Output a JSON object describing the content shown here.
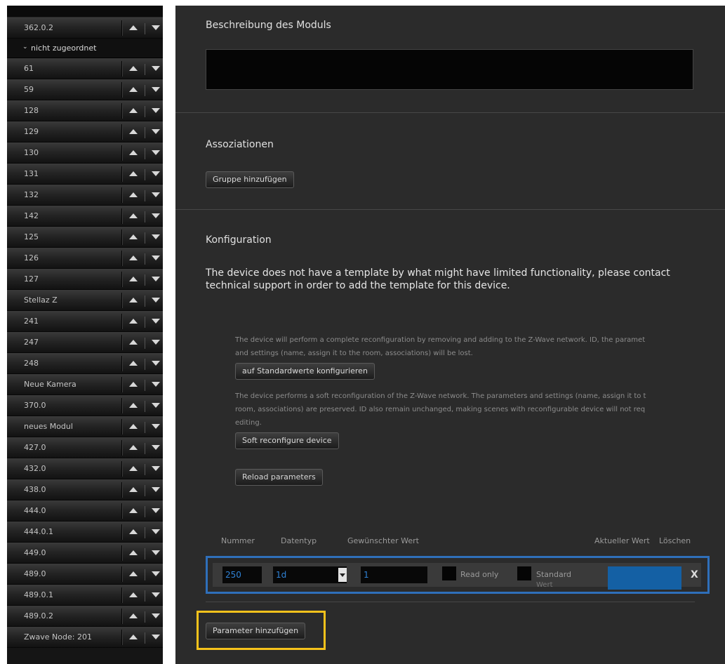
{
  "sidebar": {
    "items": [
      {
        "type": "item",
        "label": "362.0.2"
      },
      {
        "type": "group",
        "label": "nicht zugeordnet",
        "chevron": "⌄"
      },
      {
        "type": "item",
        "label": "61"
      },
      {
        "type": "item",
        "label": "59"
      },
      {
        "type": "item",
        "label": "128"
      },
      {
        "type": "item",
        "label": "129"
      },
      {
        "type": "item",
        "label": "130"
      },
      {
        "type": "item",
        "label": "131"
      },
      {
        "type": "item",
        "label": "132"
      },
      {
        "type": "item",
        "label": "142"
      },
      {
        "type": "item",
        "label": "125"
      },
      {
        "type": "item",
        "label": "126"
      },
      {
        "type": "item",
        "label": "127"
      },
      {
        "type": "item",
        "label": "Stellaz Z"
      },
      {
        "type": "item",
        "label": "241"
      },
      {
        "type": "item",
        "label": "247"
      },
      {
        "type": "item",
        "label": "248"
      },
      {
        "type": "item",
        "label": "Neue Kamera"
      },
      {
        "type": "item",
        "label": "370.0"
      },
      {
        "type": "item",
        "label": "neues Modul"
      },
      {
        "type": "item",
        "label": "427.0"
      },
      {
        "type": "item",
        "label": "432.0"
      },
      {
        "type": "item",
        "label": "438.0"
      },
      {
        "type": "item",
        "label": "444.0"
      },
      {
        "type": "item",
        "label": "444.0.1"
      },
      {
        "type": "item",
        "label": "449.0"
      },
      {
        "type": "item",
        "label": "489.0"
      },
      {
        "type": "item",
        "label": "489.0.1"
      },
      {
        "type": "item",
        "label": "489.0.2"
      },
      {
        "type": "item",
        "label": "Zwave Node: 201"
      }
    ]
  },
  "main": {
    "description_title": "Beschreibung des Moduls",
    "description_value": "",
    "associations_title": "Assoziationen",
    "add_group_button": "Gruppe hinzufügen",
    "config_title": "Konfiguration",
    "warning_text": "The device does not have a template by what might have limited functionality, please contact technical support in order to add the template for this device.",
    "reset_desc_line1": "The device will perform a complete reconfiguration by removing and adding to the Z-Wave network. ID, the paramet",
    "reset_desc_line2": "and settings (name, assign it to the room, associations) will be lost.",
    "reset_button": "auf Standardwerte konfigurieren",
    "soft_desc_line1": "The device performs a soft reconfiguration of the Z-Wave network. The parameters and settings (name, assign it to t",
    "soft_desc_line2": "room, associations) are preserved. ID also remain unchanged, making scenes with reconfigurable device will not req",
    "soft_desc_line3": "editing.",
    "soft_button": "Soft reconfigure device",
    "reload_button": "Reload parameters",
    "table": {
      "headers": {
        "number": "Nummer",
        "datatype": "Datentyp",
        "desired": "Gewünschter Wert",
        "current": "Aktueller Wert",
        "delete": "Löschen"
      },
      "row": {
        "number": "250",
        "datatype": "1d",
        "desired": "1",
        "readonly_label": "Read only",
        "standard_label_1": "Standard",
        "standard_label_2": "Wert",
        "delete_label": "X"
      }
    },
    "add_param_button": "Parameter hinzufügen"
  },
  "colors": {
    "highlight_row": "#2f6fba",
    "highlight_button": "#f5c21b",
    "current_value_fill": "#1460a4"
  }
}
